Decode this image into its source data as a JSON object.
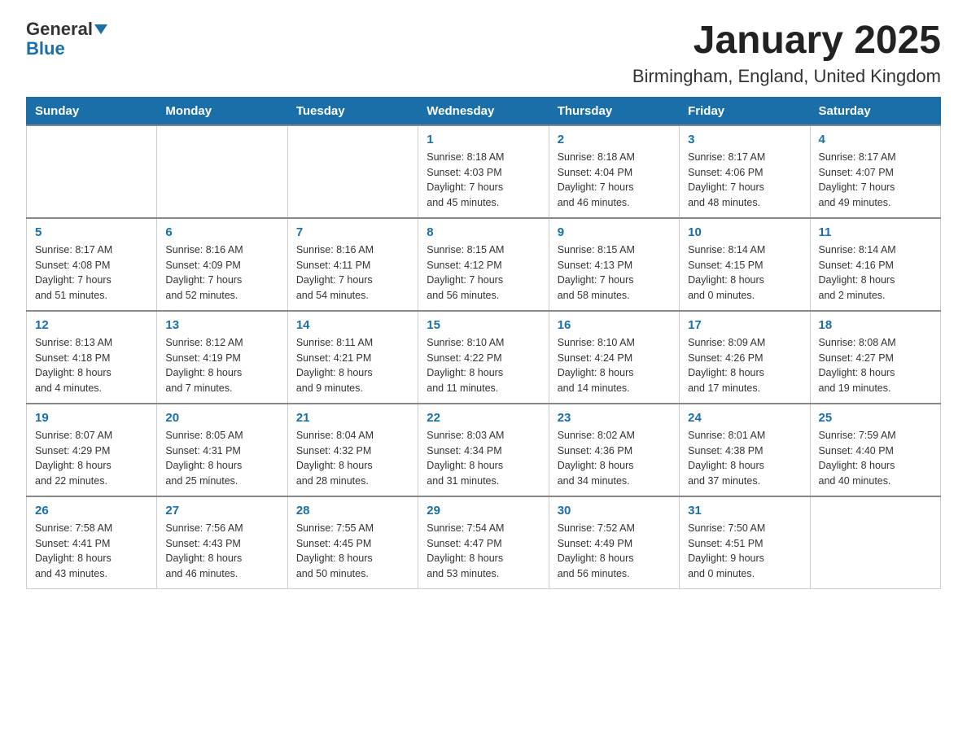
{
  "header": {
    "logo_general": "General",
    "logo_blue": "Blue",
    "title": "January 2025",
    "subtitle": "Birmingham, England, United Kingdom"
  },
  "days": [
    "Sunday",
    "Monday",
    "Tuesday",
    "Wednesday",
    "Thursday",
    "Friday",
    "Saturday"
  ],
  "weeks": [
    [
      {
        "day": "",
        "info": ""
      },
      {
        "day": "",
        "info": ""
      },
      {
        "day": "",
        "info": ""
      },
      {
        "day": "1",
        "info": "Sunrise: 8:18 AM\nSunset: 4:03 PM\nDaylight: 7 hours\nand 45 minutes."
      },
      {
        "day": "2",
        "info": "Sunrise: 8:18 AM\nSunset: 4:04 PM\nDaylight: 7 hours\nand 46 minutes."
      },
      {
        "day": "3",
        "info": "Sunrise: 8:17 AM\nSunset: 4:06 PM\nDaylight: 7 hours\nand 48 minutes."
      },
      {
        "day": "4",
        "info": "Sunrise: 8:17 AM\nSunset: 4:07 PM\nDaylight: 7 hours\nand 49 minutes."
      }
    ],
    [
      {
        "day": "5",
        "info": "Sunrise: 8:17 AM\nSunset: 4:08 PM\nDaylight: 7 hours\nand 51 minutes."
      },
      {
        "day": "6",
        "info": "Sunrise: 8:16 AM\nSunset: 4:09 PM\nDaylight: 7 hours\nand 52 minutes."
      },
      {
        "day": "7",
        "info": "Sunrise: 8:16 AM\nSunset: 4:11 PM\nDaylight: 7 hours\nand 54 minutes."
      },
      {
        "day": "8",
        "info": "Sunrise: 8:15 AM\nSunset: 4:12 PM\nDaylight: 7 hours\nand 56 minutes."
      },
      {
        "day": "9",
        "info": "Sunrise: 8:15 AM\nSunset: 4:13 PM\nDaylight: 7 hours\nand 58 minutes."
      },
      {
        "day": "10",
        "info": "Sunrise: 8:14 AM\nSunset: 4:15 PM\nDaylight: 8 hours\nand 0 minutes."
      },
      {
        "day": "11",
        "info": "Sunrise: 8:14 AM\nSunset: 4:16 PM\nDaylight: 8 hours\nand 2 minutes."
      }
    ],
    [
      {
        "day": "12",
        "info": "Sunrise: 8:13 AM\nSunset: 4:18 PM\nDaylight: 8 hours\nand 4 minutes."
      },
      {
        "day": "13",
        "info": "Sunrise: 8:12 AM\nSunset: 4:19 PM\nDaylight: 8 hours\nand 7 minutes."
      },
      {
        "day": "14",
        "info": "Sunrise: 8:11 AM\nSunset: 4:21 PM\nDaylight: 8 hours\nand 9 minutes."
      },
      {
        "day": "15",
        "info": "Sunrise: 8:10 AM\nSunset: 4:22 PM\nDaylight: 8 hours\nand 11 minutes."
      },
      {
        "day": "16",
        "info": "Sunrise: 8:10 AM\nSunset: 4:24 PM\nDaylight: 8 hours\nand 14 minutes."
      },
      {
        "day": "17",
        "info": "Sunrise: 8:09 AM\nSunset: 4:26 PM\nDaylight: 8 hours\nand 17 minutes."
      },
      {
        "day": "18",
        "info": "Sunrise: 8:08 AM\nSunset: 4:27 PM\nDaylight: 8 hours\nand 19 minutes."
      }
    ],
    [
      {
        "day": "19",
        "info": "Sunrise: 8:07 AM\nSunset: 4:29 PM\nDaylight: 8 hours\nand 22 minutes."
      },
      {
        "day": "20",
        "info": "Sunrise: 8:05 AM\nSunset: 4:31 PM\nDaylight: 8 hours\nand 25 minutes."
      },
      {
        "day": "21",
        "info": "Sunrise: 8:04 AM\nSunset: 4:32 PM\nDaylight: 8 hours\nand 28 minutes."
      },
      {
        "day": "22",
        "info": "Sunrise: 8:03 AM\nSunset: 4:34 PM\nDaylight: 8 hours\nand 31 minutes."
      },
      {
        "day": "23",
        "info": "Sunrise: 8:02 AM\nSunset: 4:36 PM\nDaylight: 8 hours\nand 34 minutes."
      },
      {
        "day": "24",
        "info": "Sunrise: 8:01 AM\nSunset: 4:38 PM\nDaylight: 8 hours\nand 37 minutes."
      },
      {
        "day": "25",
        "info": "Sunrise: 7:59 AM\nSunset: 4:40 PM\nDaylight: 8 hours\nand 40 minutes."
      }
    ],
    [
      {
        "day": "26",
        "info": "Sunrise: 7:58 AM\nSunset: 4:41 PM\nDaylight: 8 hours\nand 43 minutes."
      },
      {
        "day": "27",
        "info": "Sunrise: 7:56 AM\nSunset: 4:43 PM\nDaylight: 8 hours\nand 46 minutes."
      },
      {
        "day": "28",
        "info": "Sunrise: 7:55 AM\nSunset: 4:45 PM\nDaylight: 8 hours\nand 50 minutes."
      },
      {
        "day": "29",
        "info": "Sunrise: 7:54 AM\nSunset: 4:47 PM\nDaylight: 8 hours\nand 53 minutes."
      },
      {
        "day": "30",
        "info": "Sunrise: 7:52 AM\nSunset: 4:49 PM\nDaylight: 8 hours\nand 56 minutes."
      },
      {
        "day": "31",
        "info": "Sunrise: 7:50 AM\nSunset: 4:51 PM\nDaylight: 9 hours\nand 0 minutes."
      },
      {
        "day": "",
        "info": ""
      }
    ]
  ]
}
